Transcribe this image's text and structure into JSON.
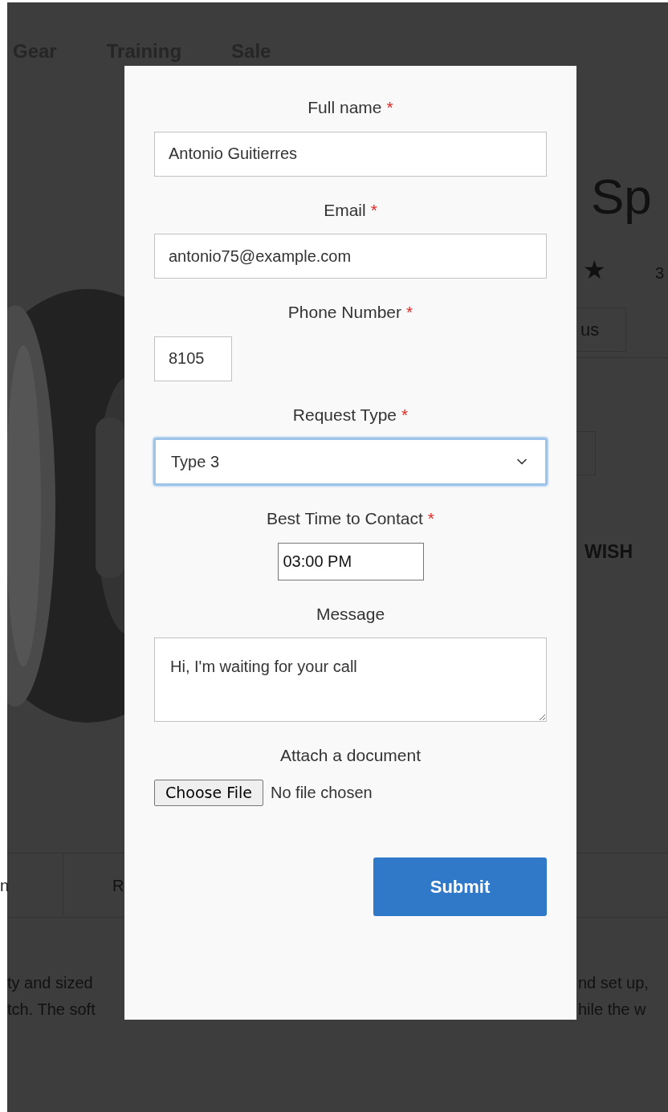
{
  "background_page": {
    "nav": [
      "Gear",
      "Training",
      "Sale"
    ],
    "heading": "Sp",
    "rating_star": "★",
    "rating_count": "3",
    "contact_button": "us",
    "wish_list": "WISH",
    "tabs": [
      "n",
      "R"
    ],
    "description_left": [
      "ty and sized",
      "tch. The soft"
    ],
    "description_right": [
      "nd set up,",
      "hile the w"
    ],
    "image": {
      "kind": "picture"
    }
  },
  "form": {
    "fields": [
      {
        "kind": "text",
        "label": "Full name",
        "marker": "*",
        "value": "Antonio Guitierres"
      },
      {
        "kind": "text",
        "label": "Email",
        "marker": "*",
        "value": "antonio75@example.com"
      },
      {
        "kind": "phone",
        "label": "Phone Number",
        "marker": "*",
        "value": "8105"
      },
      {
        "kind": "select",
        "label": "Request Type",
        "marker": "*",
        "value": "Type 3",
        "focused": true
      },
      {
        "kind": "time",
        "label": "Best Time to Contact",
        "marker": "*",
        "value": "03:00 PM"
      },
      {
        "kind": "textarea",
        "label": "Message",
        "value": "Hi, I'm waiting for your call"
      },
      {
        "kind": "file",
        "label": "Attach a document",
        "button": "Choose File",
        "status": "No file chosen"
      }
    ],
    "submit": "Submit"
  }
}
